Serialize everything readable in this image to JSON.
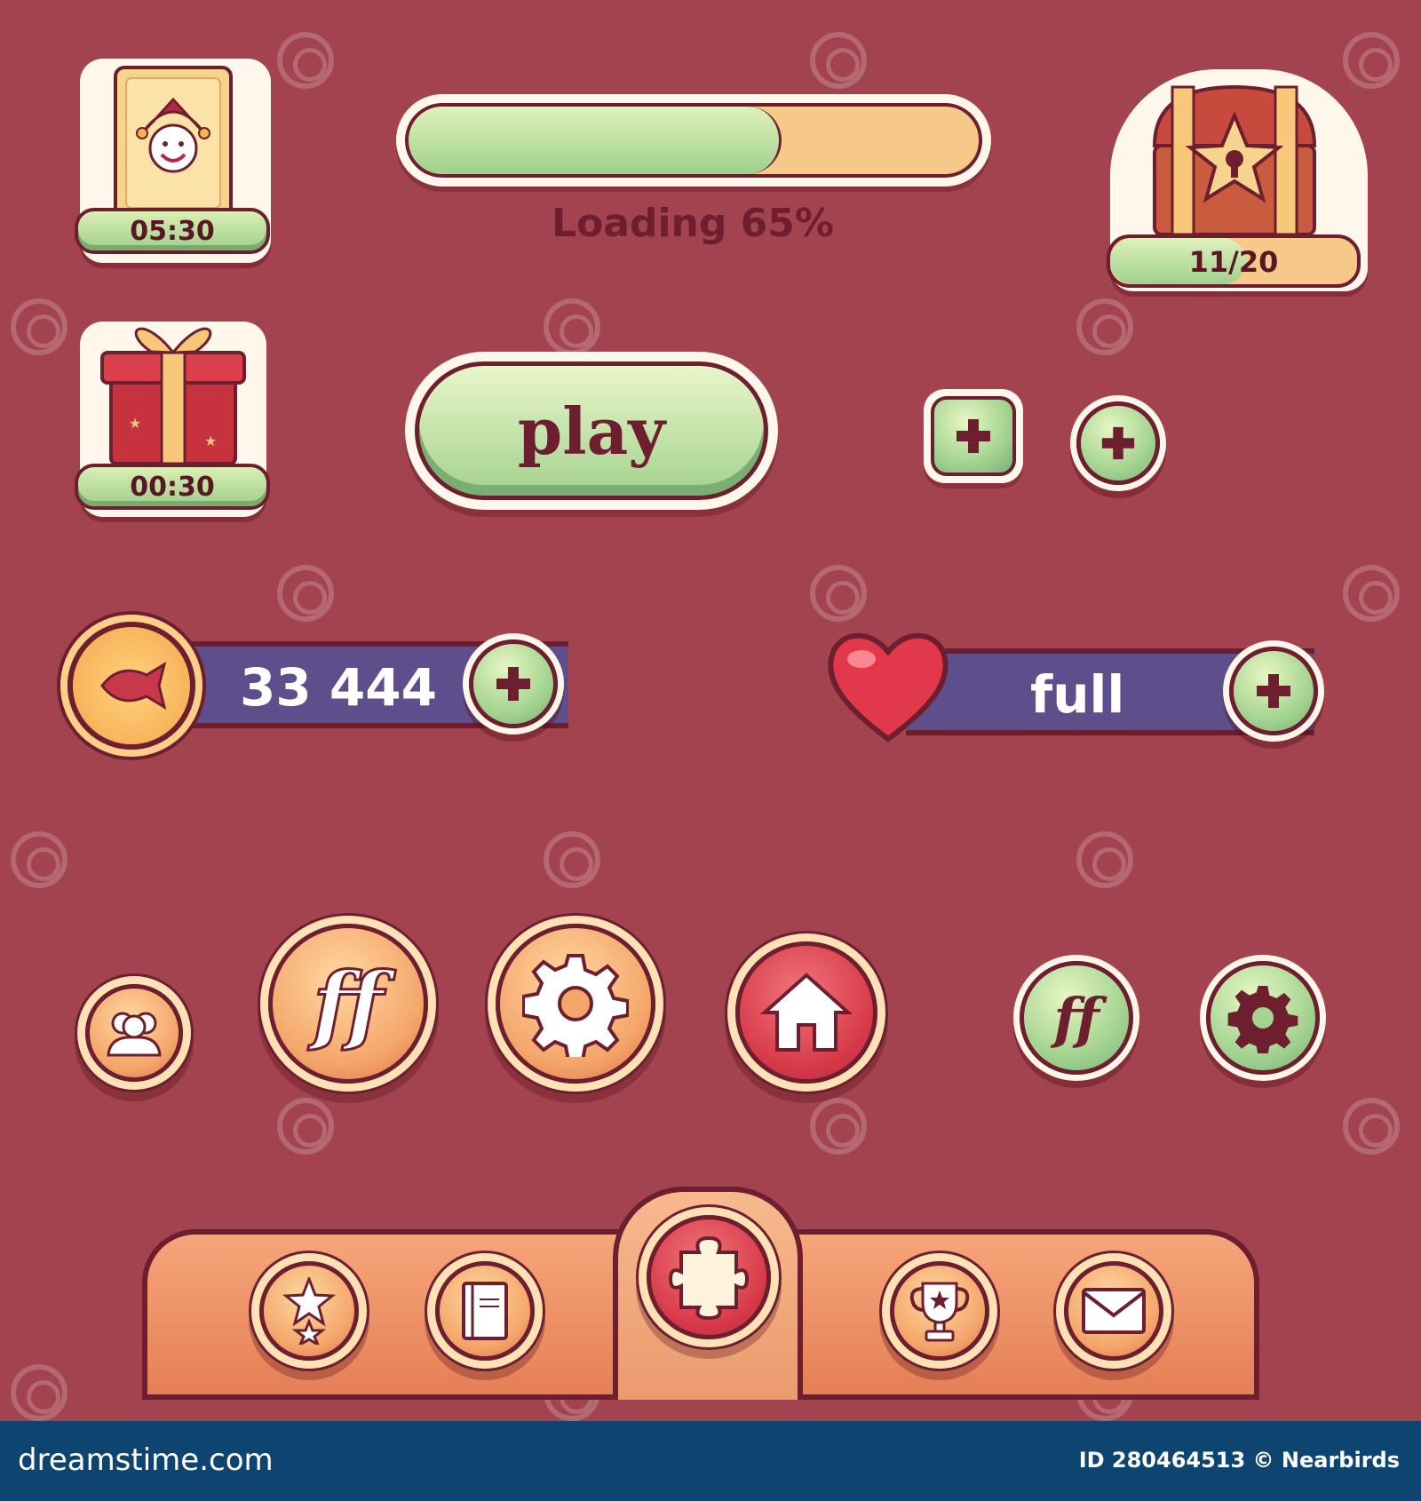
{
  "colors": {
    "background": "#a2434f",
    "green": "#a5d491",
    "orange": "#f4a56a",
    "red": "#d83b4a",
    "outline": "#6d1f2f",
    "purple_bar": "#5e4f8c",
    "footer_bar": "#0e4470"
  },
  "rewards": {
    "joker_card": {
      "icon": "joker-card-icon",
      "timer": "05:30"
    },
    "gift_box": {
      "icon": "gift-box-icon",
      "timer": "00:30"
    },
    "treasure_chest": {
      "icon": "treasure-chest-icon",
      "counter": "11/20",
      "progress": 0.55
    }
  },
  "loading": {
    "label": "Loading 65%",
    "progress": 0.65
  },
  "play_button": {
    "label": "play"
  },
  "plus_buttons": {
    "square_icon": "plus-icon",
    "round_icon": "plus-icon"
  },
  "coins_bar": {
    "icon": "fish-coin-icon",
    "value": "33 444",
    "add_icon": "plus-icon"
  },
  "lives_bar": {
    "icon": "heart-icon",
    "value": "full",
    "add_icon": "plus-icon"
  },
  "round_buttons": {
    "friends": "friends-icon",
    "ff_large": "ff",
    "settings": "gear-icon",
    "home": "home-icon",
    "ff_small": "ff",
    "settings_small": "gear-icon"
  },
  "bottom_nav": {
    "items": [
      {
        "name": "stars",
        "icon": "stars-icon"
      },
      {
        "name": "book",
        "icon": "book-icon"
      },
      {
        "name": "puzzle",
        "icon": "puzzle-piece-icon"
      },
      {
        "name": "trophy",
        "icon": "trophy-icon"
      },
      {
        "name": "mail",
        "icon": "mail-icon"
      }
    ]
  },
  "footer": {
    "site": "dreamstime.com",
    "id_text": "ID 280464513 © Nearbirds",
    "watermark": "dreamstime"
  }
}
